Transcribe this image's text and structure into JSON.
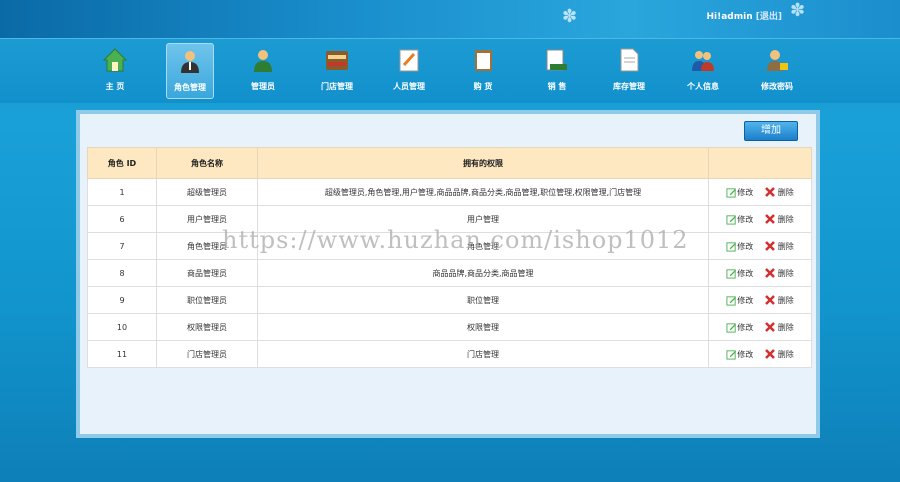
{
  "header": {
    "greeting_prefix": "Hi!",
    "username": "admin",
    "logout_label": "[退出]"
  },
  "nav": [
    {
      "label": "主  页",
      "icon": "home-icon"
    },
    {
      "label": "角色管理",
      "icon": "role-icon",
      "active": true
    },
    {
      "label": "管理员",
      "icon": "admin-icon"
    },
    {
      "label": "门店管理",
      "icon": "store-icon"
    },
    {
      "label": "人员管理",
      "icon": "staff-icon"
    },
    {
      "label": "购  货",
      "icon": "purchase-icon"
    },
    {
      "label": "销  售",
      "icon": "sales-icon"
    },
    {
      "label": "库存管理",
      "icon": "inventory-icon"
    },
    {
      "label": "个人信息",
      "icon": "profile-icon"
    },
    {
      "label": "修改密码",
      "icon": "password-icon"
    }
  ],
  "toolbar": {
    "add_label": "增加"
  },
  "table": {
    "headers": [
      "角色 ID",
      "角色名称",
      "拥有的权限",
      ""
    ],
    "edit_label": "修改",
    "delete_label": "删除",
    "rows": [
      {
        "id": "1",
        "name": "超级管理员",
        "perms": "超级管理员,角色管理,用户管理,商品品牌,商品分类,商品管理,职位管理,权限管理,门店管理"
      },
      {
        "id": "6",
        "name": "用户管理员",
        "perms": "用户管理"
      },
      {
        "id": "7",
        "name": "角色管理员",
        "perms": "角色管理"
      },
      {
        "id": "8",
        "name": "商品管理员",
        "perms": "商品品牌,商品分类,商品管理"
      },
      {
        "id": "9",
        "name": "职位管理员",
        "perms": "职位管理"
      },
      {
        "id": "10",
        "name": "权限管理员",
        "perms": "权限管理"
      },
      {
        "id": "11",
        "name": "门店管理员",
        "perms": "门店管理"
      }
    ]
  },
  "watermark": "https://www.huzhan.com/ishop1012"
}
